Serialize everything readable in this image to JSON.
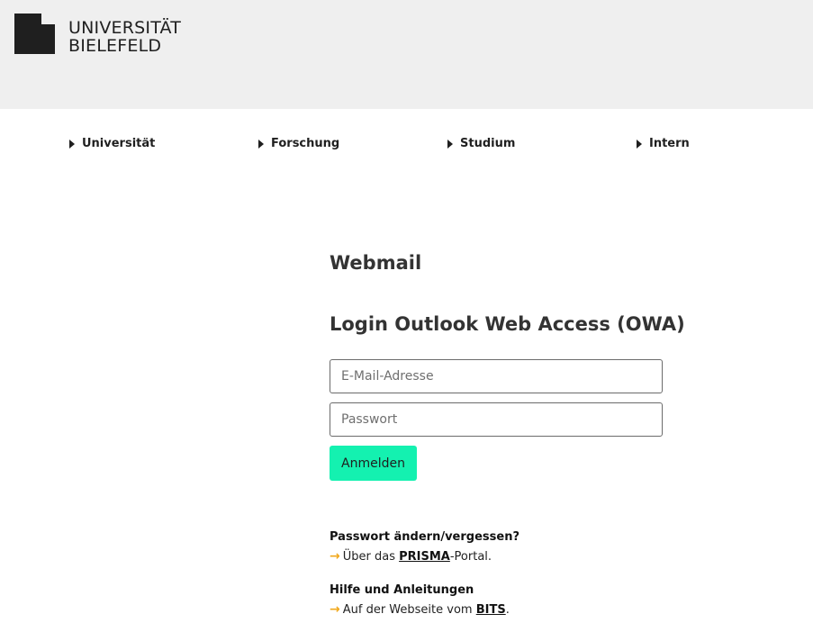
{
  "header": {
    "logo_line1": "UNIVERSITÄT",
    "logo_line2": "BIELEFELD"
  },
  "nav": {
    "items": [
      {
        "label": "Universität"
      },
      {
        "label": "Forschung"
      },
      {
        "label": "Studium"
      },
      {
        "label": "Intern"
      }
    ]
  },
  "main": {
    "title": "Webmail",
    "subtitle": "Login Outlook Web Access (OWA)",
    "email_placeholder": "E-Mail-Adresse",
    "password_placeholder": "Passwort",
    "login_button": "Anmelden"
  },
  "help": {
    "section1_title": "Passwort ändern/vergessen?",
    "section1_prefix": "Über das ",
    "section1_link": "PRISMA",
    "section1_suffix": "-Portal.",
    "section2_title": "Hilfe und Anleitungen",
    "section2_prefix": "Auf der Webseite vom ",
    "section2_link": "BITS",
    "section2_suffix": ".",
    "arrow_icon": "→"
  },
  "colors": {
    "header_bg": "#efefef",
    "button_bg": "#14f1b0",
    "arrow": "#f1a81c"
  }
}
